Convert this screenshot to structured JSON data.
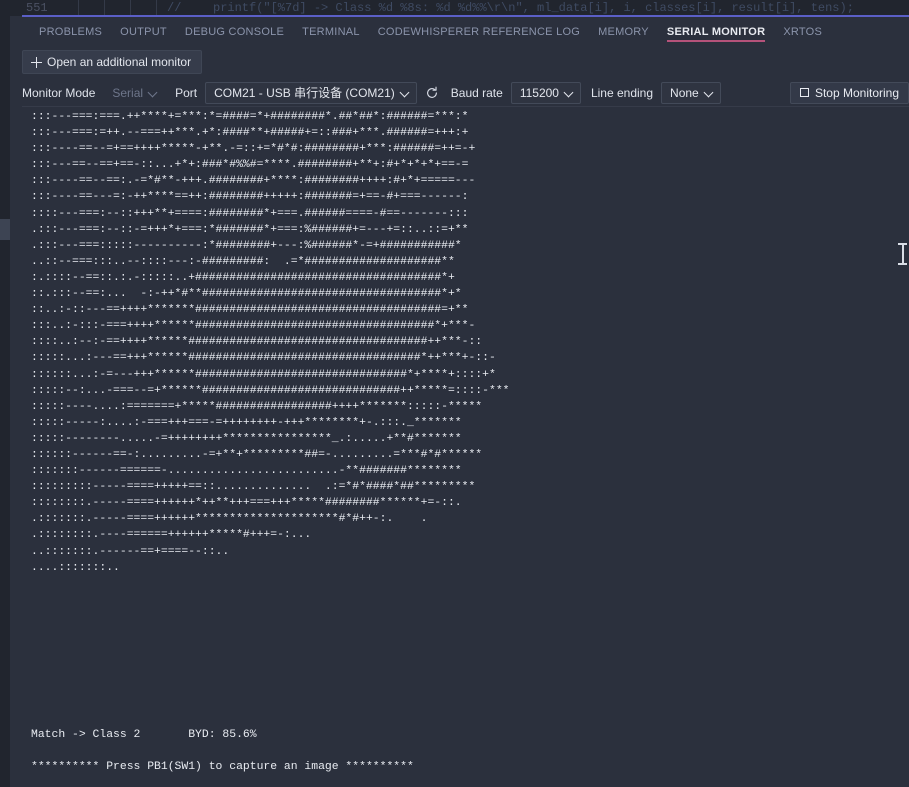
{
  "editor": {
    "line_number": "551",
    "comment_marker": "//",
    "code_text": "printf(\"[%7d] -> Class %d %8s: %d %d%%\\r\\n\", ml_data[i], i, classes[i], result[i], tens);"
  },
  "panel_tabs": [
    {
      "label": "PROBLEMS",
      "active": false
    },
    {
      "label": "OUTPUT",
      "active": false
    },
    {
      "label": "DEBUG CONSOLE",
      "active": false
    },
    {
      "label": "TERMINAL",
      "active": false
    },
    {
      "label": "CODEWHISPERER REFERENCE LOG",
      "active": false
    },
    {
      "label": "MEMORY",
      "active": false
    },
    {
      "label": "SERIAL MONITOR",
      "active": true
    },
    {
      "label": "XRTOS",
      "active": false
    }
  ],
  "toolbar": {
    "open_additional_monitor": "Open an additional monitor",
    "monitor_mode_label": "Monitor Mode",
    "monitor_mode_value": "Serial",
    "port_label": "Port",
    "port_value": "COM21 - USB 串行设备 (COM21)",
    "baud_rate_label": "Baud rate",
    "baud_rate_value": "115200",
    "line_ending_label": "Line ending",
    "line_ending_value": "None",
    "stop_monitoring_label": "Stop Monitoring"
  },
  "serial_output": {
    "ascii_art": ":::---===:===.++****+=***:*=####=*+########*.##*##*:######=***:*\n:::---===:=++.--===++***.+*:####**+#####+=::###+***.######=+++:+\n:::----==--=+==++++*****-+**.-=::+=*#*#:########+***:######=++=-+\n:::---==--==+==-::...+*+:###*#%%#=****.########+**+:#+*+*+*+==-=\n:::----==--==:.-=*#**-+++.########+****:########++++:#+*+=====---\n:::----==---=:-++****==++:########+++++:#######=+==-#+===------:\n::::---===:--::+++**+====:########*+===.######====-#==-------:::\n.:::---===:--::-=+++*+===:*#######*+===:%######+=---+=::..::=+**\n.:::---===:::::----------:*########+---:%######*-=+###########*\n..::--===:::..--::::---:-#########:  .=*####################**\n:.::::--==::.:.-:::::..+####################################*+\n::.:::--==:...  -:-++*#**###################################*+*\n::..:-::---==++++*******####################################=+**\n:::..:-:::-===++++******###################################*+***-\n::::..:--:-==++++******###################################++***-::\n:::::...:---==+++******##################################*++***+-::-\n::::::...:-=---+++******###############################*+****+::::+*\n:::::--:...-===--=+******#############################++*****=::::-***\n:::::----....:=======+*****#################++++*******:::::-*****\n:::::-----:....:-===+++===-=++++++++-+++********+-.:::._*******\n:::::--------.....-=++++++++****************_.:.....+**#*******\n::::::------==-:.........-=+**+*********##=-.........=***#*#******\n:::::::------======-.........................-**#######********\n:::::::::-----====+++++==::..............  .:=*#*####*##*********\n::::::::.-----====++++++*++**+++===+++*****########******+=-::.\n.:::::::.-----====++++++*********************#*#++-:.    .\n.::::::::.----======++++++*****#+++=-:...\n..:::::::.------==+====--::..\n....:::::::..",
    "match_line": "Match -> Class 2       BYD: 85.6%",
    "prompt_line": "********** Press PB1(SW1) to capture an image **********"
  },
  "icons": {
    "plus": "plus-icon",
    "chevron_down": "chevron-down-icon",
    "refresh": "refresh-icon",
    "stop_square": "stop-square-icon",
    "text_cursor": "i-beam-cursor"
  },
  "colors": {
    "panel_bg": "#2b303d",
    "active_tab_underline": "#b5527a",
    "text_primary": "#e9ecf2",
    "text_muted": "#8b94ab",
    "editor_divider": "#5b5fc7"
  }
}
